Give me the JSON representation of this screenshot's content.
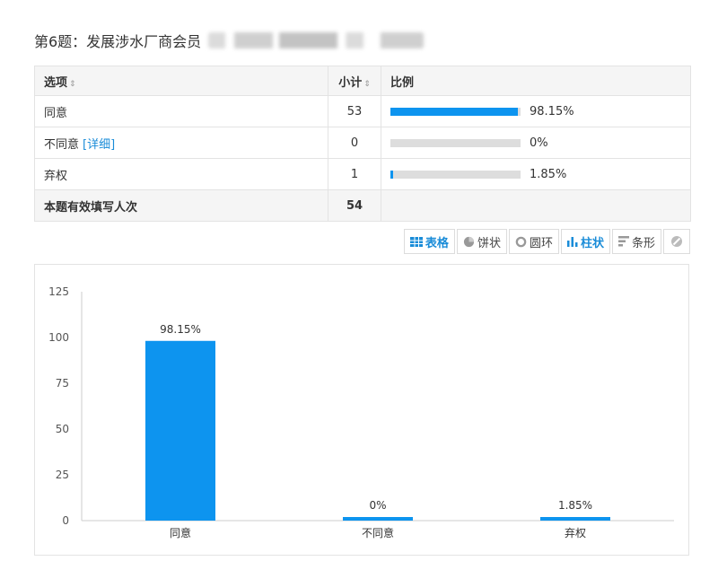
{
  "title": "第6题：发展涉水厂商会员",
  "table": {
    "headers": {
      "option": "选项",
      "count": "小计",
      "ratio": "比例"
    },
    "rows": [
      {
        "label": "同意",
        "count": "53",
        "percent_text": "98.15%",
        "percent": 98.15,
        "detail": ""
      },
      {
        "label": "不同意",
        "count": "0",
        "percent_text": "0%",
        "percent": 0,
        "detail": "[详细]"
      },
      {
        "label": "弃权",
        "count": "1",
        "percent_text": "1.85%",
        "percent": 1.85,
        "detail": ""
      }
    ],
    "total_label": "本题有效填写人次",
    "total_value": "54"
  },
  "toolbar": {
    "table": "表格",
    "pie": "饼状",
    "ring": "圆环",
    "column": "柱状",
    "bar": "条形"
  },
  "colors": {
    "accent": "#0d94ef",
    "link": "#1a8cd8",
    "track": "#dddddd"
  },
  "chart_data": {
    "type": "bar",
    "categories": [
      "同意",
      "不同意",
      "弃权"
    ],
    "values": [
      98.15,
      0,
      1.85
    ],
    "data_labels": [
      "98.15%",
      "0%",
      "1.85%"
    ],
    "yticks": [
      0,
      25,
      50,
      75,
      100,
      125
    ],
    "ylim": [
      0,
      125
    ],
    "title": "",
    "xlabel": "",
    "ylabel": "",
    "grid": false,
    "legend": "none"
  }
}
